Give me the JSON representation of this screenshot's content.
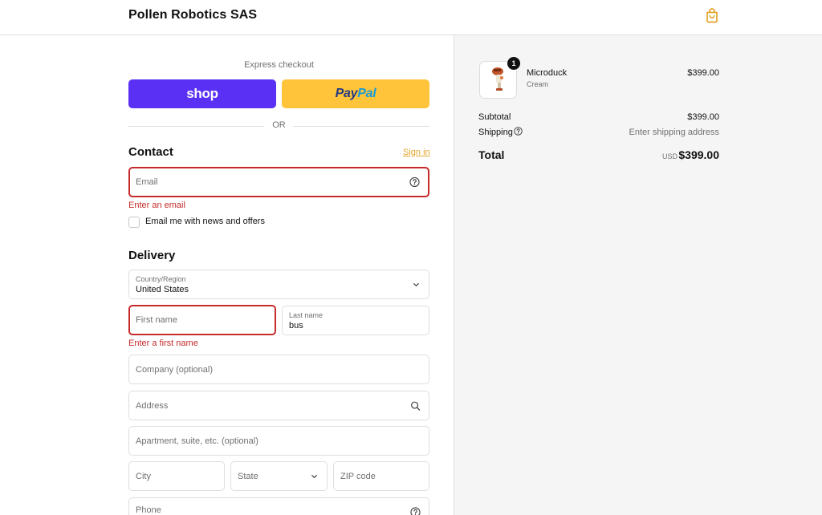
{
  "header": {
    "brand": "Pollen Robotics SAS",
    "bag_icon": "shopping-bag-icon",
    "accent_color": "#e2a32a"
  },
  "express": {
    "label": "Express checkout",
    "shop_label": "shop",
    "paypal_part1": "Pay",
    "paypal_part2": "Pal",
    "or_label": "OR"
  },
  "contact": {
    "title": "Contact",
    "signin_label": "Sign in",
    "email_placeholder": "Email",
    "email_error": "Enter an email",
    "news_label": "Email me with news and offers",
    "help_icon": "question-circle-icon"
  },
  "delivery": {
    "title": "Delivery",
    "country_label": "Country/Region",
    "country_value": "United States",
    "first_name_placeholder": "First name",
    "first_name_error": "Enter a first name",
    "last_name_label": "Last name",
    "last_name_value": "bus",
    "company_placeholder": "Company (optional)",
    "address_placeholder": "Address",
    "apartment_placeholder": "Apartment, suite, etc. (optional)",
    "city_placeholder": "City",
    "state_placeholder": "State",
    "zip_placeholder": "ZIP code",
    "phone_placeholder": "Phone"
  },
  "summary": {
    "item": {
      "name": "Microduck",
      "variant": "Cream",
      "price": "$399.00",
      "quantity": "1"
    },
    "subtotal_label": "Subtotal",
    "subtotal_value": "$399.00",
    "shipping_label": "Shipping",
    "shipping_value": "Enter shipping address",
    "total_label": "Total",
    "total_currency": "USD",
    "total_value": "$399.00"
  },
  "colors": {
    "error": "#c52a2a",
    "shop_purple": "#5a31f4",
    "paypal_yellow": "#ffc439"
  }
}
